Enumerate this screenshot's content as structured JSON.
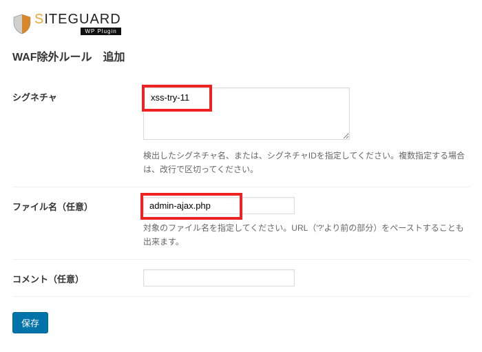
{
  "logo": {
    "prefix": "S",
    "rest": "ITEGUARD",
    "sub": "WP Plugin"
  },
  "page_title": "WAF除外ルール　追加",
  "fields": {
    "signature": {
      "label": "シグネチャ",
      "value": "xss-try-11",
      "hint": "検出したシグネチャ名、または、シグネチャIDを指定してください。複数指定する場合は、改行で区切ってください。"
    },
    "filename": {
      "label": "ファイル名（任意）",
      "value": "admin-ajax.php",
      "hint": "対象のファイル名を指定してください。URL（'?'より前の部分）をペーストすることも出来ます。"
    },
    "comment": {
      "label": "コメント（任意）",
      "value": ""
    }
  },
  "buttons": {
    "save": "保存"
  }
}
